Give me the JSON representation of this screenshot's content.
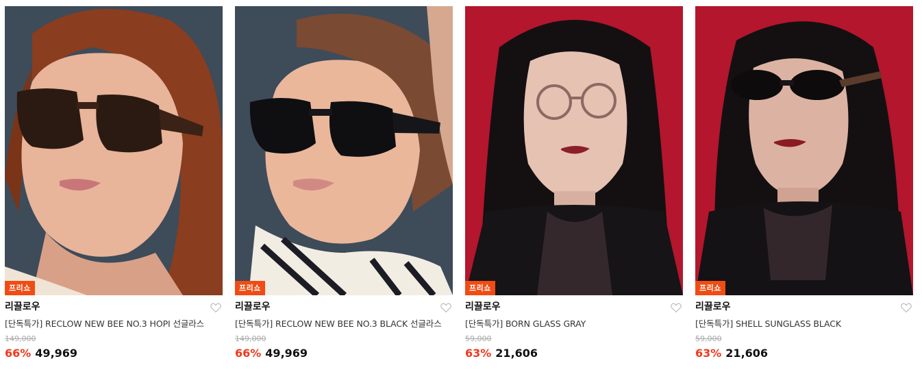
{
  "products": [
    {
      "badge": "프리쇼",
      "brand": "리끌로우",
      "name": "[단독특가] RECLOW NEW BEE NO.3 HOPI 선글라스",
      "original_price": "149,000",
      "discount": "66%",
      "price": "49,969",
      "image_desc": "tortoise-sunglasses-model"
    },
    {
      "badge": "프리쇼",
      "brand": "리끌로우",
      "name": "[단독특가] RECLOW NEW BEE NO.3 BLACK 선글라스",
      "original_price": "149,000",
      "discount": "66%",
      "price": "49,969",
      "image_desc": "black-sunglasses-model"
    },
    {
      "badge": "프리쇼",
      "brand": "리끌로우",
      "name": "[단독특가] BORN GLASS GRAY",
      "original_price": "59,000",
      "discount": "63%",
      "price": "21,606",
      "image_desc": "clear-glasses-model"
    },
    {
      "badge": "프리쇼",
      "brand": "리끌로우",
      "name": "[단독특가] SHELL SUNGLASS BLACK",
      "original_price": "59,000",
      "discount": "63%",
      "price": "21,606",
      "image_desc": "oval-sunglasses-model"
    }
  ],
  "colors": {
    "badge": "#f04c13",
    "discount": "#f0381b",
    "backdrop_blue": "#3d4a57",
    "backdrop_red": "#b5172f"
  },
  "icons": {
    "wishlist": "heart-outline-icon"
  }
}
